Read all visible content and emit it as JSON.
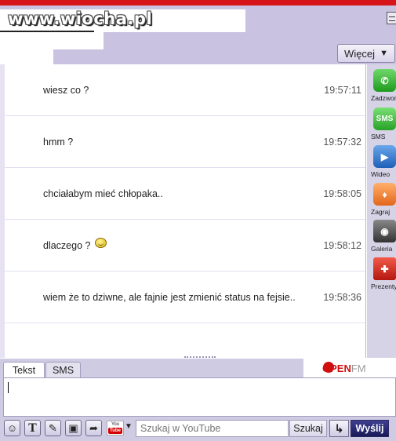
{
  "watermark": "www.wiocha.pl",
  "header": {
    "more_label": "Więcej",
    "more_caret": "▼"
  },
  "messages": [
    {
      "text": "wiesz co ?",
      "time": "19:57:11"
    },
    {
      "text": "hmm ?",
      "time": "19:57:32"
    },
    {
      "text": "chciałabym mieć chłopaka..",
      "time": "19:58:05"
    },
    {
      "text": "dlaczego ?",
      "time": "19:58:12",
      "emoticon": "smiley-icon"
    },
    {
      "text": "wiem że to dziwne, ale fajnie jest zmienić status na fejsie..",
      "time": "19:58:36"
    }
  ],
  "sidebar": {
    "items": [
      {
        "label": "Zadzwoń",
        "icon": "phone-icon",
        "glyph": "✆"
      },
      {
        "label": "SMS",
        "icon": "sms-icon",
        "glyph": "SMS"
      },
      {
        "label": "Wideo",
        "icon": "video-camera-icon",
        "glyph": "▶"
      },
      {
        "label": "Zagraj",
        "icon": "game-icon",
        "glyph": "♦"
      },
      {
        "label": "Galeria",
        "icon": "camera-icon",
        "glyph": "◉"
      },
      {
        "label": "Prezenty",
        "icon": "gift-icon",
        "glyph": "✚"
      }
    ]
  },
  "composer": {
    "tabs": [
      "Tekst",
      "SMS"
    ],
    "radio": {
      "brand": "OPEN",
      "suffix": "FM"
    },
    "message_value": ""
  },
  "toolbar": {
    "youtube_logo_top": "You",
    "youtube_logo_bottom": "Tube",
    "youtube_caret": "▼",
    "youtube_placeholder": "Szukaj w YouTube",
    "search_label": "Szukaj",
    "enter_glyph": "↳",
    "send_label": "Wyślij"
  },
  "colors": {
    "accent": "#c9c2e0",
    "topbar": "#d8141b",
    "send": "#24246b",
    "radio": "#d01010"
  }
}
